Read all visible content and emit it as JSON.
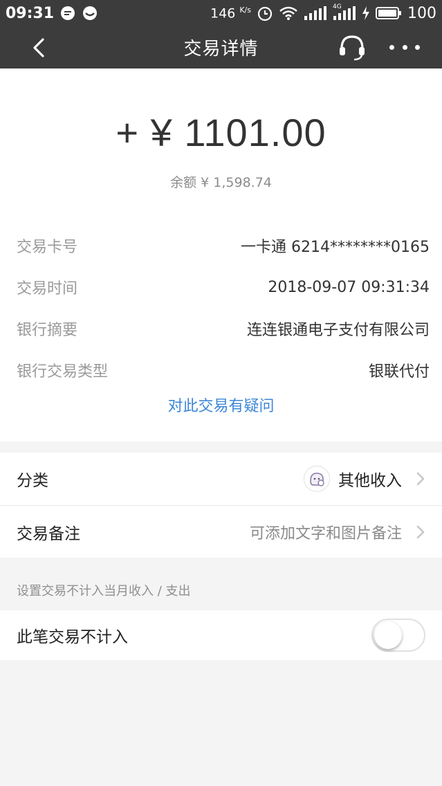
{
  "status_bar": {
    "time": "09:31",
    "net_speed": "146",
    "net_unit": "K/s",
    "network": "4G",
    "battery": "100"
  },
  "nav": {
    "title": "交易详情"
  },
  "summary": {
    "amount": "+ ¥ 1101.00",
    "balance": "余额 ¥ 1,598.74"
  },
  "details": [
    {
      "label": "交易卡号",
      "value": "一卡通 6214********0165"
    },
    {
      "label": "交易时间",
      "value": "2018-09-07 09:31:34"
    },
    {
      "label": "银行摘要",
      "value": "连连银通电子支付有限公司"
    },
    {
      "label": "银行交易类型",
      "value": "银联代付"
    }
  ],
  "question_link": "对此交易有疑问",
  "category": {
    "label": "分类",
    "value": "其他收入"
  },
  "note": {
    "label": "交易备注",
    "placeholder": "可添加文字和图片备注"
  },
  "exclude_hint": "设置交易不计入当月收入 / 支出",
  "exclude": {
    "label": "此笔交易不计入",
    "enabled": false
  },
  "colors": {
    "topbar": "#3c3c3c",
    "link": "#3d87d8",
    "background": "#f4f4f4"
  }
}
